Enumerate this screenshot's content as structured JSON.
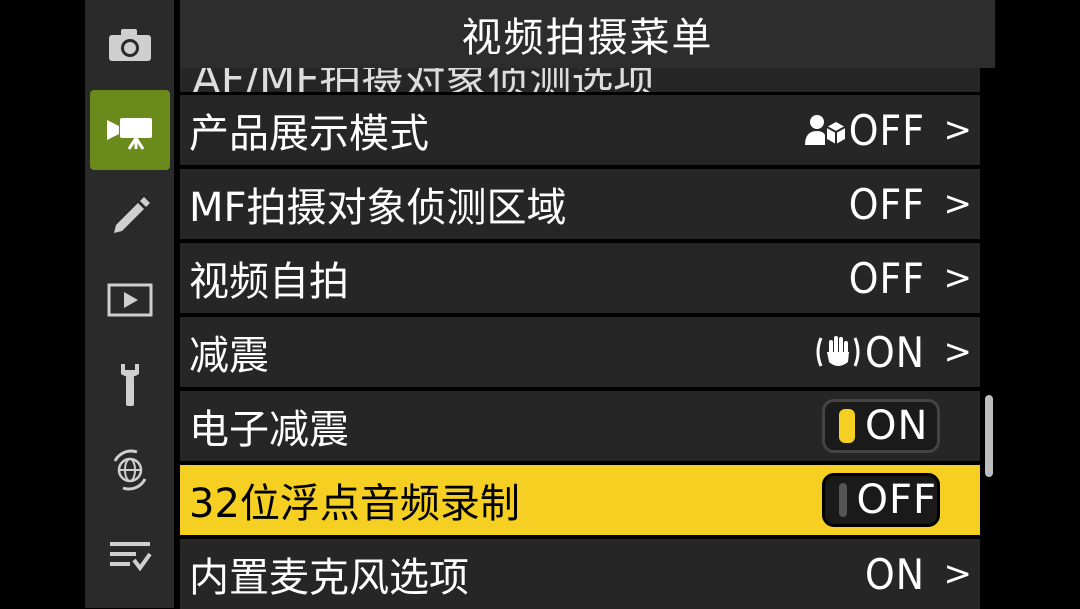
{
  "header": {
    "title": "视频拍摄菜单"
  },
  "sidebar": {
    "items": [
      {
        "icon": "camera-icon",
        "active": false
      },
      {
        "icon": "movie-camera-icon",
        "active": true
      },
      {
        "icon": "pencil-icon",
        "active": false
      },
      {
        "icon": "playback-icon",
        "active": false
      },
      {
        "icon": "wrench-icon",
        "active": false
      },
      {
        "icon": "network-icon",
        "active": false
      },
      {
        "icon": "my-menu-icon",
        "active": false
      }
    ]
  },
  "menu": {
    "partial_label": "AF/MF拍摄对象侦测选项",
    "rows": [
      {
        "label": "产品展示模式",
        "value": "OFF",
        "value_icon": "product-review-icon",
        "chevron": ">"
      },
      {
        "label": "MF拍摄对象侦测区域",
        "value": "OFF",
        "chevron": ">"
      },
      {
        "label": "视频自拍",
        "value": "OFF",
        "chevron": ">"
      },
      {
        "label": "减震",
        "value": "ON",
        "value_icon": "vibration-reduction-icon",
        "chevron": ">"
      },
      {
        "label": "电子减震",
        "toggle": "ON"
      },
      {
        "label": "32位浮点音频录制",
        "toggle": "OFF",
        "selected": true
      },
      {
        "label": "内置麦克风选项",
        "value": "ON",
        "chevron": ">"
      }
    ]
  },
  "colors": {
    "accent_yellow": "#f5cf21",
    "active_tab_green": "#6b8a1c"
  }
}
